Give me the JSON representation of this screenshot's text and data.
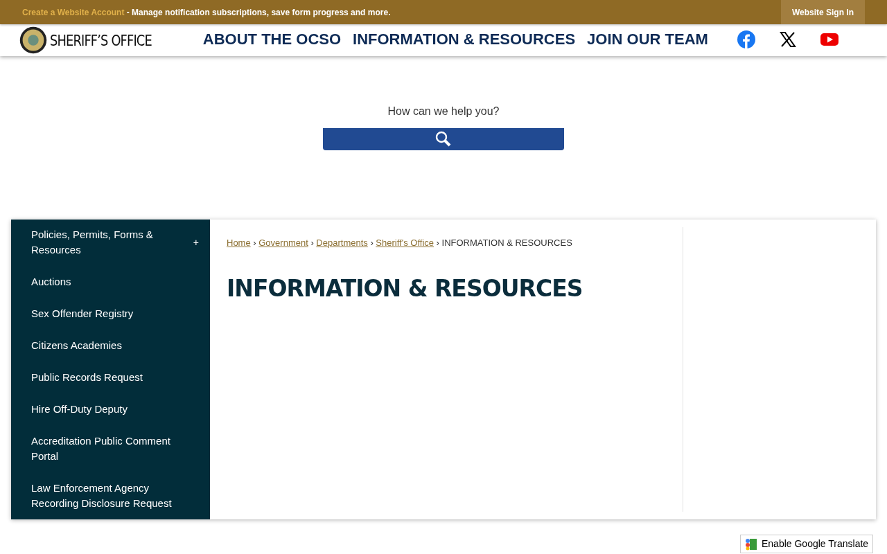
{
  "top_bar": {
    "account_link": "Create a Website Account",
    "message": "- Manage notification subscriptions, save form progress and more.",
    "sign_in": "Website Sign In"
  },
  "header": {
    "logo_text": "SHERIFF’S OFFICE",
    "nav": [
      "ABOUT THE OCSO",
      "INFORMATION & RESOURCES",
      "JOIN OUR TEAM"
    ],
    "social": [
      {
        "kind": "facebook"
      },
      {
        "kind": "x"
      },
      {
        "kind": "youtube"
      }
    ]
  },
  "search": {
    "label": "How can we help you?"
  },
  "sidebar": {
    "items": [
      {
        "label": "Policies, Permits, Forms & Resources",
        "expandable": true,
        "expand_sign": "+"
      },
      {
        "label": "Auctions",
        "expandable": false
      },
      {
        "label": "Sex Offender Registry",
        "expandable": false
      },
      {
        "label": "Citizens Academies",
        "expandable": false
      },
      {
        "label": "Public Records Request",
        "expandable": false
      },
      {
        "label": "Hire Off-Duty Deputy",
        "expandable": false
      },
      {
        "label": "Accreditation Public Comment Portal",
        "expandable": false
      },
      {
        "label": "Law Enforcement Agency Recording Disclosure Request",
        "expandable": false
      }
    ]
  },
  "breadcrumb": [
    {
      "label": "Home",
      "link": true
    },
    {
      "label": "Government",
      "link": true
    },
    {
      "label": "Departments",
      "link": true
    },
    {
      "label": "Sheriff's Office",
      "link": true
    },
    {
      "label": "INFORMATION & RESOURCES",
      "link": false
    }
  ],
  "breadcrumb_separator": "›",
  "page_title": "INFORMATION & RESOURCES",
  "translate_button": "Enable Google Translate"
}
